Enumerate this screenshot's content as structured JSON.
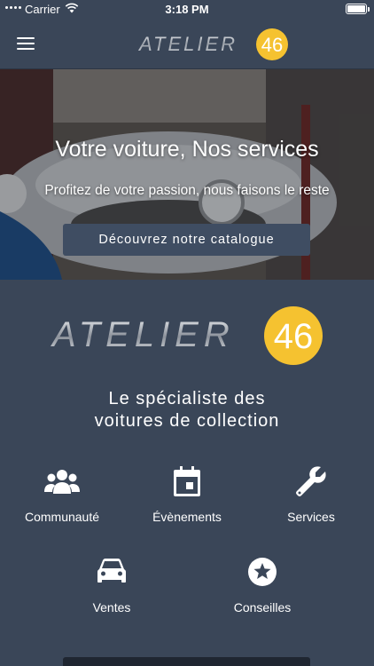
{
  "status_bar": {
    "carrier": "Carrier",
    "time": "3:18 PM"
  },
  "nav": {
    "logo_text": "ATELIER",
    "logo_number": "46"
  },
  "hero": {
    "title": "Votre voiture, Nos services",
    "subtitle": "Profitez de votre passion, nous faisons le reste",
    "cta_label": "Découvrez notre catalogue"
  },
  "brand": {
    "logo_text": "ATELIER",
    "logo_number": "46",
    "tagline_line1": "Le spécialiste des",
    "tagline_line2": "voitures de collection"
  },
  "features": [
    {
      "label": "Communauté",
      "icon": "group-icon"
    },
    {
      "label": "Évènements",
      "icon": "calendar-icon"
    },
    {
      "label": "Services",
      "icon": "wrench-icon"
    },
    {
      "label": "Ventes",
      "icon": "car-icon"
    },
    {
      "label": "Conseilles",
      "icon": "star-badge-icon"
    }
  ],
  "colors": {
    "background": "#3a4658",
    "accent_yellow": "#f5c230",
    "button": "#3f4d62"
  }
}
